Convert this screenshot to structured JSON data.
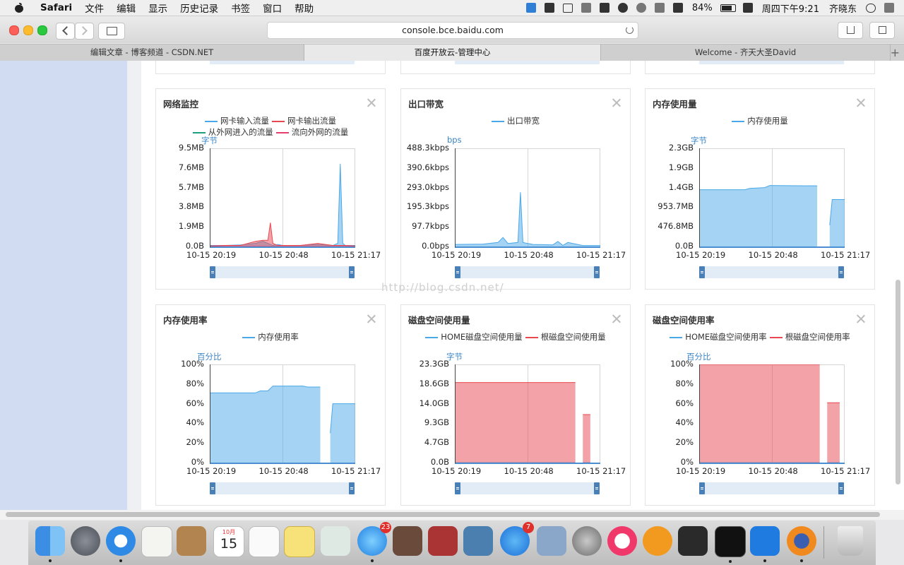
{
  "menubar": {
    "app_name": "Safari",
    "items": [
      "文件",
      "编辑",
      "显示",
      "历史记录",
      "书签",
      "窗口",
      "帮助"
    ],
    "battery": "84%",
    "clock": "周四下午9:21",
    "user": "齐晓东"
  },
  "browser": {
    "url": "console.bce.baidu.com",
    "tabs": [
      {
        "label": "编辑文章 - 博客频道 - CSDN.NET"
      },
      {
        "label": "百度开放云-管理中心"
      },
      {
        "label": "Welcome - 齐天大圣David"
      }
    ],
    "active_tab": 1
  },
  "panels": [
    {
      "title": "网络监控",
      "legend": [
        {
          "name": "网卡输入流量",
          "color": "#4aa8e8"
        },
        {
          "name": "网卡输出流量",
          "color": "#e8474f"
        },
        {
          "name": "从外网进入的流量",
          "color": "#1a9f7f"
        },
        {
          "name": "流向外网的流量",
          "color": "#e63c6e"
        }
      ],
      "unit": "字节",
      "y_ticks": [
        "9.5MB",
        "7.6MB",
        "5.7MB",
        "3.8MB",
        "1.9MB",
        "0.0B"
      ],
      "x_ticks": [
        "10-15 20:19",
        "10-15 20:48",
        "10-15 21:17"
      ]
    },
    {
      "title": "出口带宽",
      "legend": [
        {
          "name": "出口带宽",
          "color": "#4aa8e8"
        }
      ],
      "unit": "bps",
      "y_ticks": [
        "488.3kbps",
        "390.6kbps",
        "293.0kbps",
        "195.3kbps",
        "97.7kbps",
        "0.0bps"
      ],
      "x_ticks": [
        "10-15 20:19",
        "10-15 20:48",
        "10-15 21:17"
      ]
    },
    {
      "title": "内存使用量",
      "legend": [
        {
          "name": "内存使用量",
          "color": "#4aa8e8"
        }
      ],
      "unit": "字节",
      "y_ticks": [
        "2.3GB",
        "1.9GB",
        "1.4GB",
        "953.7MB",
        "476.8MB",
        "0.0B"
      ],
      "x_ticks": [
        "10-15 20:19",
        "10-15 20:48",
        "10-15 21:17"
      ]
    },
    {
      "title": "内存使用率",
      "legend": [
        {
          "name": "内存使用率",
          "color": "#4aa8e8"
        }
      ],
      "unit": "百分比",
      "y_ticks": [
        "100%",
        "80%",
        "60%",
        "40%",
        "20%",
        "0%"
      ],
      "x_ticks": [
        "10-15 20:19",
        "10-15 20:48",
        "10-15 21:17"
      ]
    },
    {
      "title": "磁盘空间使用量",
      "legend": [
        {
          "name": "HOME磁盘空间使用量",
          "color": "#4aa8e8"
        },
        {
          "name": "根磁盘空间使用量",
          "color": "#e8474f"
        }
      ],
      "unit": "字节",
      "y_ticks": [
        "23.3GB",
        "18.6GB",
        "14.0GB",
        "9.3GB",
        "4.7GB",
        "0.0B"
      ],
      "x_ticks": [
        "10-15 20:19",
        "10-15 20:48",
        "10-15 21:17"
      ]
    },
    {
      "title": "磁盘空间使用率",
      "legend": [
        {
          "name": "HOME磁盘空间使用率",
          "color": "#4aa8e8"
        },
        {
          "name": "根磁盘空间使用率",
          "color": "#e8474f"
        }
      ],
      "unit": "百分比",
      "y_ticks": [
        "100%",
        "80%",
        "60%",
        "40%",
        "20%",
        "0%"
      ],
      "x_ticks": [
        "10-15 20:19",
        "10-15 20:48",
        "10-15 21:17"
      ]
    }
  ],
  "chart_data": [
    {
      "type": "area",
      "title": "网络监控",
      "ylabel": "字节",
      "ylim": [
        0,
        9.5
      ],
      "y_unit": "MB",
      "x": [
        "20:19",
        "20:25",
        "20:31",
        "20:37",
        "20:40",
        "20:42",
        "20:43",
        "20:44",
        "20:46",
        "20:48",
        "20:55",
        "21:02",
        "21:08",
        "21:10",
        "21:11",
        "21:12",
        "21:13",
        "21:17"
      ],
      "series": [
        {
          "name": "网卡输入流量",
          "values": [
            0.1,
            0.1,
            0.15,
            0.3,
            0.5,
            0.3,
            0.2,
            0.1,
            0.2,
            0.1,
            0.1,
            0.2,
            0.1,
            0.3,
            8.0,
            0.3,
            0.1,
            0.1
          ]
        },
        {
          "name": "网卡输出流量",
          "values": [
            0.05,
            0.1,
            0.1,
            0.5,
            0.6,
            0.6,
            2.3,
            0.3,
            0.1,
            0.1,
            0.1,
            0.3,
            0.1,
            0.1,
            0.1,
            0.1,
            0.1,
            0.05
          ]
        },
        {
          "name": "从外网进入的流量",
          "values": [
            0,
            0,
            0,
            0,
            0,
            0,
            0,
            0,
            0,
            0,
            0,
            0,
            0,
            0,
            0,
            0,
            0,
            0
          ]
        },
        {
          "name": "流向外网的流量",
          "values": [
            0,
            0,
            0,
            0,
            0,
            0,
            0,
            0,
            0,
            0,
            0,
            0,
            0,
            0,
            0,
            0,
            0,
            0
          ]
        }
      ]
    },
    {
      "type": "area",
      "title": "出口带宽",
      "ylabel": "bps",
      "ylim": [
        0,
        488.3
      ],
      "y_unit": "kbps",
      "x": [
        "20:19",
        "20:30",
        "20:36",
        "20:38",
        "20:40",
        "20:44",
        "20:45",
        "20:46",
        "20:50",
        "20:58",
        "21:00",
        "21:02",
        "21:04",
        "21:10",
        "21:17"
      ],
      "series": [
        {
          "name": "出口带宽",
          "values": [
            10,
            12,
            20,
            45,
            15,
            20,
            270,
            20,
            10,
            8,
            25,
            5,
            20,
            5,
            5
          ]
        }
      ]
    },
    {
      "type": "area",
      "title": "内存使用量",
      "ylabel": "字节",
      "ylim": [
        0,
        2.3
      ],
      "y_unit": "GB",
      "x": [
        "20:19",
        "20:37",
        "20:39",
        "20:45",
        "20:47",
        "21:06",
        "21:07",
        "21:11",
        "21:12",
        "21:17"
      ],
      "series": [
        {
          "name": "内存使用量",
          "values": [
            1.33,
            1.33,
            1.36,
            1.38,
            1.43,
            1.42,
            null,
            0.5,
            1.1,
            1.1
          ]
        }
      ]
    },
    {
      "type": "area",
      "title": "内存使用率",
      "ylabel": "百分比",
      "ylim": [
        0,
        100
      ],
      "y_unit": "%",
      "x": [
        "20:19",
        "20:37",
        "20:39",
        "20:42",
        "20:44",
        "20:56",
        "20:58",
        "21:03",
        "21:04",
        "21:07",
        "21:08",
        "21:17"
      ],
      "series": [
        {
          "name": "内存使用率",
          "values": [
            71,
            71,
            73,
            73,
            78,
            78,
            77,
            77,
            null,
            30,
            60,
            60
          ]
        }
      ]
    },
    {
      "type": "area",
      "title": "磁盘空间使用量",
      "ylabel": "字节",
      "ylim": [
        0,
        23.3
      ],
      "y_unit": "GB",
      "x": [
        "20:19",
        "20:48",
        "21:07",
        "21:08",
        "21:10",
        "21:13"
      ],
      "series": [
        {
          "name": "HOME磁盘空间使用量",
          "values": [
            0,
            0,
            0,
            null,
            0,
            0
          ]
        },
        {
          "name": "根磁盘空间使用量",
          "values": [
            19.0,
            19.0,
            19.0,
            null,
            11.4,
            11.4
          ]
        }
      ]
    },
    {
      "type": "area",
      "title": "磁盘空间使用率",
      "ylabel": "百分比",
      "ylim": [
        0,
        100
      ],
      "y_unit": "%",
      "x": [
        "20:19",
        "20:48",
        "21:07",
        "21:08",
        "21:10",
        "21:15"
      ],
      "series": [
        {
          "name": "HOME磁盘空间使用率",
          "values": [
            0,
            0,
            0,
            null,
            0,
            0
          ]
        },
        {
          "name": "根磁盘空间使用率",
          "values": [
            100,
            100,
            100,
            null,
            61,
            61
          ]
        }
      ]
    }
  ],
  "watermark": "http://blog.csdn.net/",
  "dock": {
    "calendar_month": "10月",
    "calendar_day": "15",
    "messages_badge": "23",
    "appstore_badge": "7"
  }
}
